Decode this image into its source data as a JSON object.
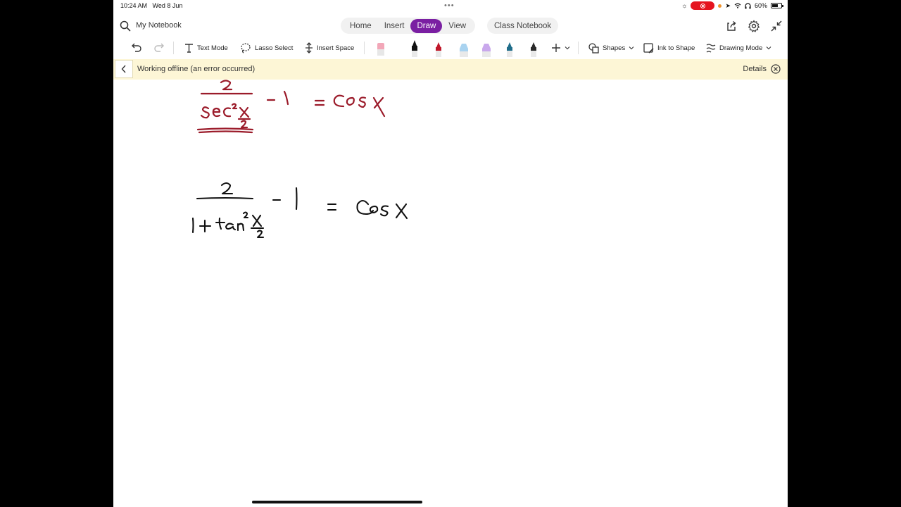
{
  "status_bar": {
    "time": "10:24 AM",
    "date": "Wed 8 Jun",
    "battery_text": "60%",
    "recording_color": "#e5141f"
  },
  "header": {
    "notebook_name": "My Notebook",
    "tabs": [
      {
        "label": "Home",
        "active": false
      },
      {
        "label": "Insert",
        "active": false
      },
      {
        "label": "Draw",
        "active": true
      },
      {
        "label": "View",
        "active": false
      }
    ],
    "class_notebook": "Class Notebook",
    "accent_color": "#7a1fa2",
    "icons": [
      "search-icon",
      "share-icon",
      "gear-icon",
      "collapse-icon"
    ]
  },
  "toolbar": {
    "text_mode": "Text Mode",
    "lasso_select": "Lasso Select",
    "insert_space": "Insert Space",
    "shapes": "Shapes",
    "ink_to_shape": "Ink to Shape",
    "drawing_mode": "Drawing Mode",
    "pens": [
      {
        "name": "pen-eraser",
        "color": "#f2a7b8"
      },
      {
        "name": "pen-black",
        "color": "#111111"
      },
      {
        "name": "pen-red",
        "color": "#c0182a"
      },
      {
        "name": "pen-lightblue",
        "color": "#a9d3f0"
      },
      {
        "name": "pen-lavender",
        "color": "#c9a8ec"
      },
      {
        "name": "pen-teal",
        "color": "#1f6d8a"
      },
      {
        "name": "pen-darkgray",
        "color": "#2a2a2a"
      }
    ]
  },
  "banner": {
    "message": "Working offline (an error occurred)",
    "details": "Details"
  },
  "ink": {
    "red_color": "#9b1b2a",
    "black_color": "#111111"
  }
}
